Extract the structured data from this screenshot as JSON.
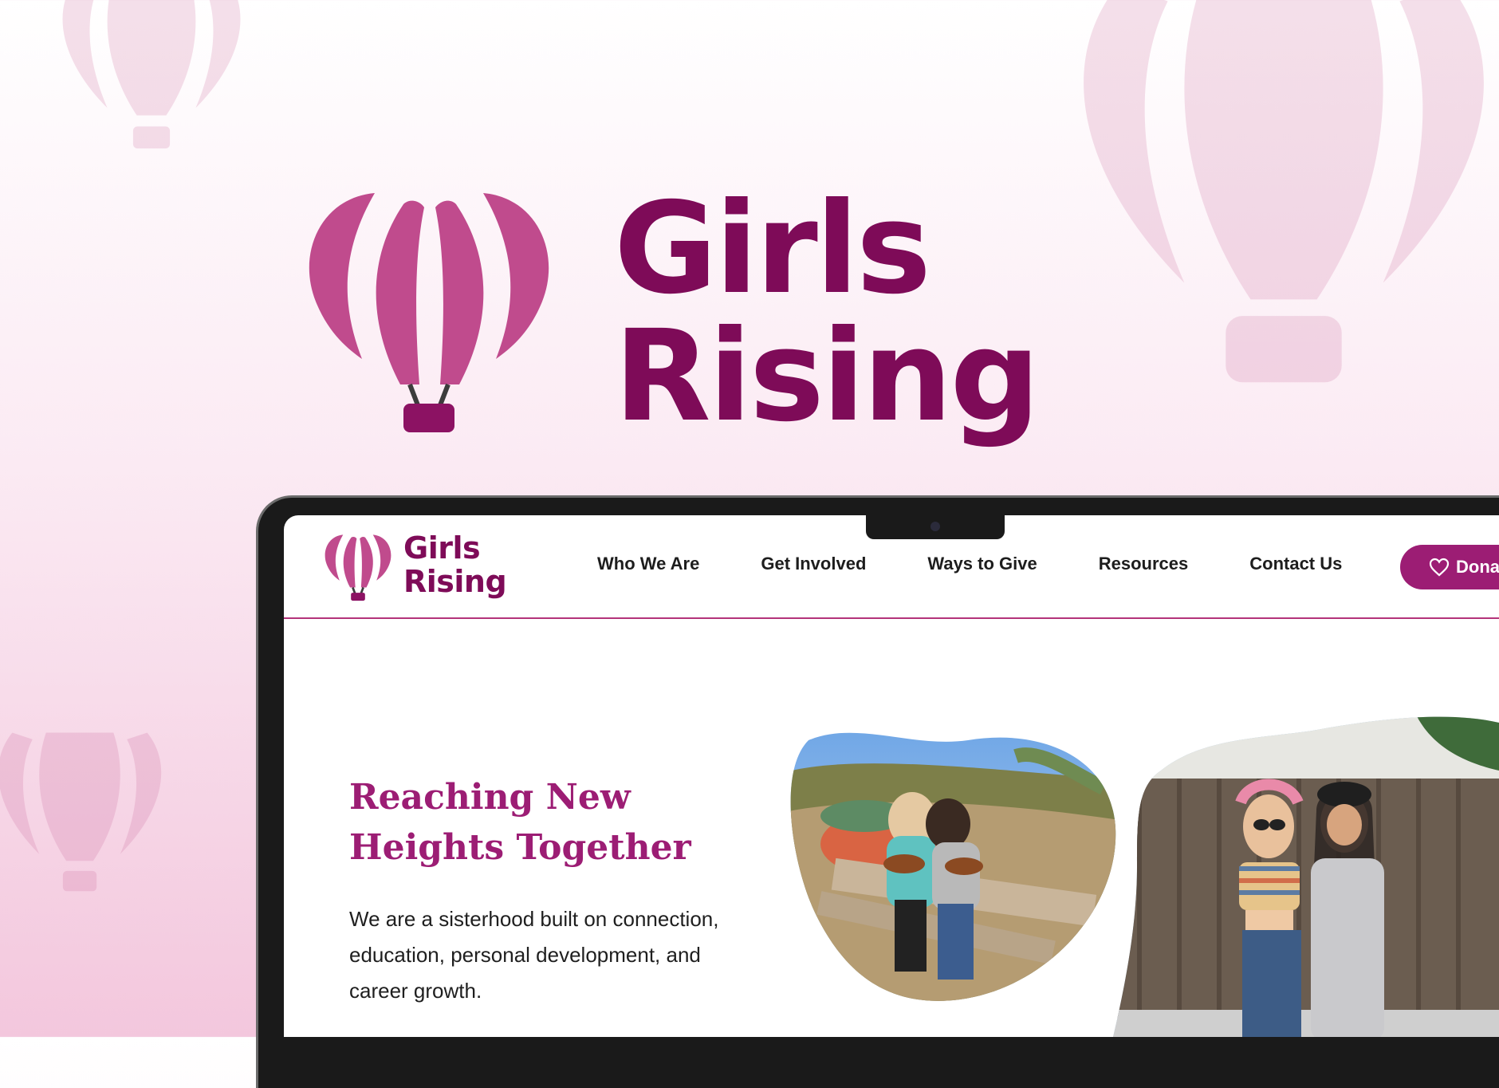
{
  "brand": {
    "name_line1": "Girls",
    "name_line2": "Rising",
    "primary_color": "#7e0b58",
    "accent_color": "#b84a8c",
    "logo_icon": "hot-air-balloon-icon"
  },
  "site": {
    "header": {
      "logo_line1": "Girls",
      "logo_line2": "Rising",
      "nav": [
        {
          "label": "Who We Are"
        },
        {
          "label": "Get Involved"
        },
        {
          "label": "Ways to Give"
        },
        {
          "label": "Resources"
        },
        {
          "label": "Contact Us"
        }
      ],
      "donate_label": "Donat",
      "donate_icon": "heart-icon",
      "donate_color": "#9c1d74"
    },
    "hero": {
      "headline_line1": "Reaching New",
      "headline_line2": "Heights Together",
      "intro_line1": "We are a sisterhood built on connection,",
      "intro_line2": "education, personal development, and",
      "intro_line3": "career growth.",
      "photos": [
        {
          "name": "outdoor-ukulele-photo"
        },
        {
          "name": "friends-fence-photo"
        }
      ]
    }
  }
}
